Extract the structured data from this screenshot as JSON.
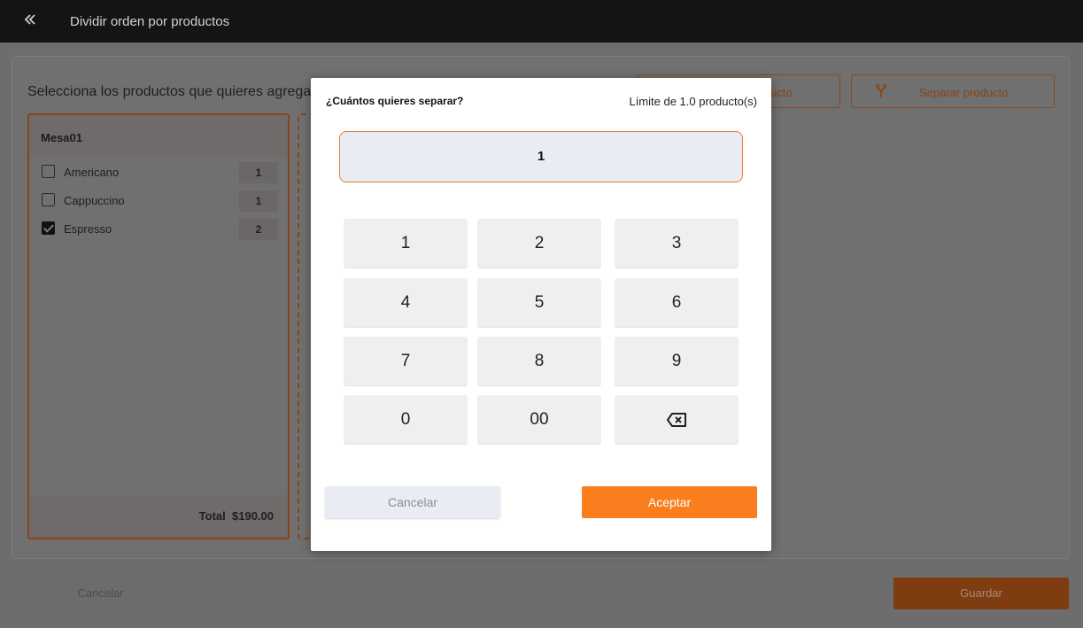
{
  "header": {
    "title": "Dividir orden por productos",
    "back_icon": "double-chevron-left-icon"
  },
  "main": {
    "instruction": "Selecciona los productos que quieres agregar",
    "actions": [
      {
        "label": "ucto"
      },
      {
        "label": "Separar producto",
        "icon": "split-icon"
      }
    ],
    "order": {
      "title": "Mesa01",
      "items": [
        {
          "label": "Americano",
          "qty": "1",
          "checked": false
        },
        {
          "label": "Cappuccino",
          "qty": "1",
          "checked": false
        },
        {
          "label": "Espresso",
          "qty": "2",
          "checked": true
        }
      ],
      "total_label": "Total",
      "total_value": "$190.00"
    }
  },
  "footer": {
    "cancel_label": "Cancelar",
    "save_label": "Guardar"
  },
  "modal": {
    "title": "¿Cuántos quieres separar?",
    "limit": "Límite de 1.0 producto(s)",
    "value": "1",
    "keys": [
      "1",
      "2",
      "3",
      "4",
      "5",
      "6",
      "7",
      "8",
      "9",
      "0",
      "00"
    ],
    "backspace_icon": "backspace-icon",
    "cancel_label": "Cancelar",
    "accept_label": "Aceptar"
  },
  "colors": {
    "accent": "#fa7d1e",
    "topbar": "#141414",
    "display_bg": "#e9ecf3"
  }
}
